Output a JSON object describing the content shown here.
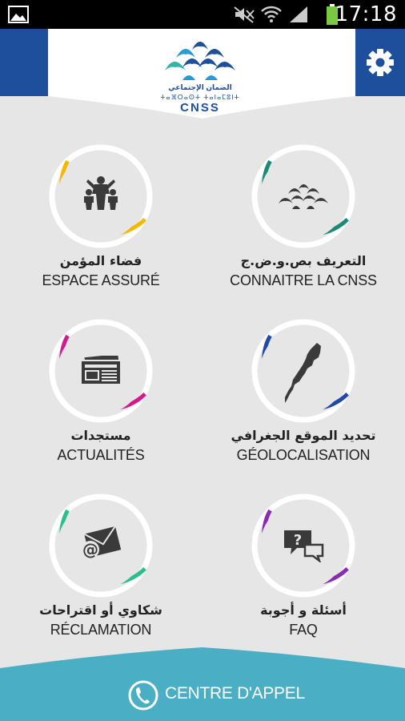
{
  "status_bar": {
    "time": "17:18"
  },
  "header": {
    "logo": {
      "arabic": "الضمان الإجتماعي",
      "berber": "ⵜⴰⴼⵔⴰⵙⵜ ⵜⴰⵏⴰⵎⵓⵏⵜ",
      "name": "CNSS"
    },
    "settings_icon": "gear-icon"
  },
  "menu": [
    {
      "id": "espace-assure",
      "label_ar": "فضاء المؤمن",
      "label_fr": "ESPACE ASSURÉ",
      "icon": "people-icon",
      "ring_color": "#f5b800"
    },
    {
      "id": "connaitre-cnss",
      "label_ar": "التعريف بص.و.ض.ج",
      "label_fr": "CONNAITRE LA CNSS",
      "icon": "cnss-logo-icon",
      "ring_color": "#1b8a7a"
    },
    {
      "id": "actualites",
      "label_ar": "مستجدات",
      "label_fr": "ACTUALITÉS",
      "icon": "newspaper-icon",
      "ring_color": "#d11b8c"
    },
    {
      "id": "geolocalisation",
      "label_ar": "تحديد الموقع الجغرافي",
      "label_fr": "GÉOLOCALISATION",
      "icon": "map-icon",
      "ring_color": "#1e4aa8"
    },
    {
      "id": "reclamation",
      "label_ar": "شكاوي أو اقتراحات",
      "label_fr": "RÉCLAMATION",
      "icon": "email-icon",
      "ring_color": "#2bbf8f"
    },
    {
      "id": "faq",
      "label_ar": "أسئلة و أجوبة",
      "label_fr": "FAQ",
      "icon": "chat-question-icon",
      "ring_color": "#8a2bb5"
    }
  ],
  "footer": {
    "label": "CENTRE D'APPEL",
    "icon": "phone-icon",
    "color": "#4aaec4"
  }
}
